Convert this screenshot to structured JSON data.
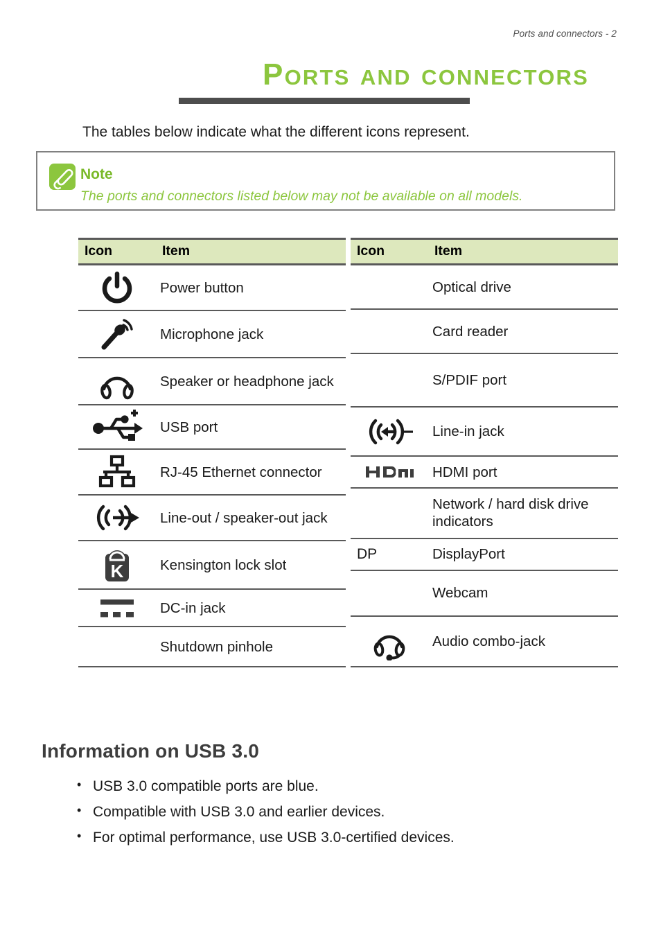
{
  "header": {
    "running_head": "Ports and connectors - 2"
  },
  "title": {
    "text": "Ports and connectors",
    "color": "#8cc63e",
    "rule_color": "#4d4d4d"
  },
  "intro": {
    "text": "The tables below indicate what the different icons represent."
  },
  "note": {
    "icon": "paperclip-icon",
    "heading": "Note",
    "body": "The ports and connectors listed below may not be available on all models.",
    "accent_color": "#8cc63e",
    "border_color": "#808080"
  },
  "tables": {
    "header_background": "#dde8bd",
    "border_color": "#595959",
    "columns": [
      "Icon",
      "Item"
    ],
    "left": {
      "headers": [
        "Icon",
        "Item"
      ],
      "rows": [
        {
          "icon": "power-button-icon",
          "icon_text": "",
          "item": "Power button"
        },
        {
          "icon": "microphone-icon",
          "icon_text": "",
          "item": "Microphone jack"
        },
        {
          "icon": "headphones-icon",
          "icon_text": "",
          "item": "Speaker or headphone jack"
        },
        {
          "icon": "usb-icon",
          "icon_text": "",
          "item": "USB port"
        },
        {
          "icon": "ethernet-icon",
          "icon_text": "",
          "item": "RJ-45 Ethernet connector"
        },
        {
          "icon": "line-out-icon",
          "icon_text": "",
          "item": "Line-out / speaker-out jack"
        },
        {
          "icon": "kensington-lock-icon",
          "icon_text": "",
          "item": "Kensington lock slot"
        },
        {
          "icon": "dc-in-icon",
          "icon_text": "",
          "item": "DC-in jack"
        },
        {
          "icon": "none",
          "icon_text": "",
          "item": "Shutdown pinhole"
        }
      ]
    },
    "right": {
      "headers": [
        "Icon",
        "Item"
      ],
      "rows": [
        {
          "icon": "none",
          "icon_text": "",
          "item": "Optical drive"
        },
        {
          "icon": "none",
          "icon_text": "",
          "item": "Card reader"
        },
        {
          "icon": "none",
          "icon_text": "",
          "item": "S/PDIF port"
        },
        {
          "icon": "line-in-icon",
          "icon_text": "",
          "item": "Line-in jack"
        },
        {
          "icon": "hdmi-icon",
          "icon_text": "",
          "item": "HDMI port"
        },
        {
          "icon": "none",
          "icon_text": "",
          "item": "Network / hard disk drive indicators"
        },
        {
          "icon": "displayport-text-icon",
          "icon_text": "DP",
          "item": "DisplayPort"
        },
        {
          "icon": "none",
          "icon_text": "",
          "item": "Webcam"
        },
        {
          "icon": "headset-icon",
          "icon_text": "",
          "item": "Audio combo-jack"
        }
      ]
    }
  },
  "usb_section": {
    "heading": "Information on USB 3.0",
    "bullets": [
      "USB 3.0 compatible ports are blue.",
      "Compatible with USB 3.0 and earlier devices.",
      "For optimal performance, use USB 3.0-certified devices."
    ]
  }
}
